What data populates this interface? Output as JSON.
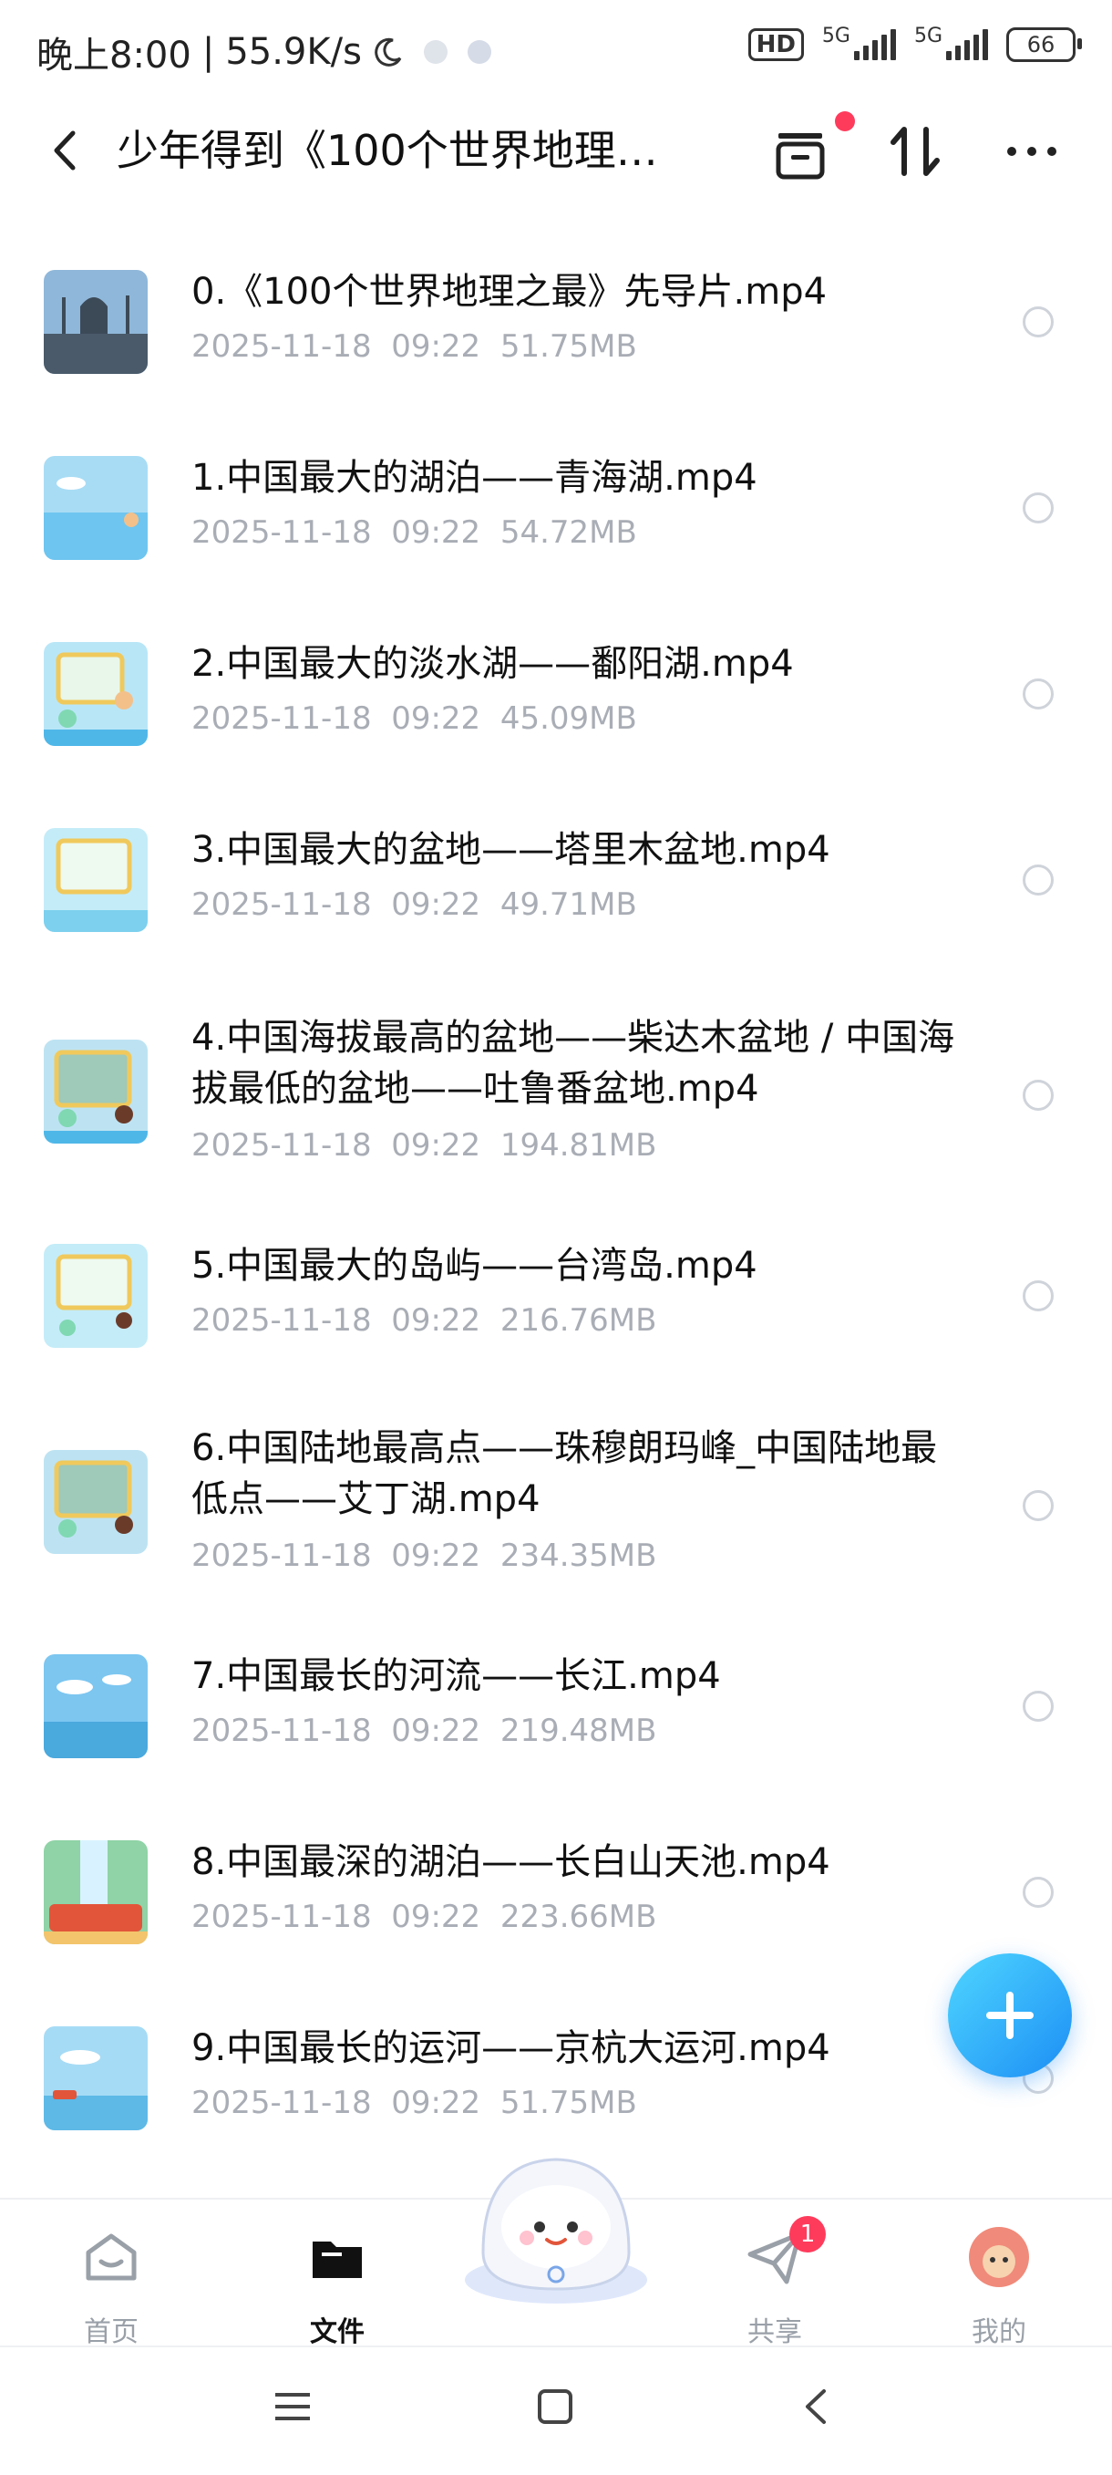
{
  "status_bar": {
    "time": "晚上8:00",
    "speed": "55.9K/s",
    "hd": "HD",
    "net1": "5G",
    "net2": "5G",
    "battery": "66"
  },
  "header": {
    "title": "少年得到《100个世界地理…",
    "icons": [
      "back-icon",
      "archive-icon",
      "sort-icon",
      "more-icon"
    ]
  },
  "files": [
    {
      "name": "0.《100个世界地理之最》先导片.mp4",
      "date": "2025-11-18  09:22",
      "size": "51.75MB"
    },
    {
      "name": "1.中国最大的湖泊——青海湖.mp4",
      "date": "2025-11-18  09:22",
      "size": "54.72MB"
    },
    {
      "name": "2.中国最大的淡水湖——鄱阳湖.mp4",
      "date": "2025-11-18  09:22",
      "size": "45.09MB"
    },
    {
      "name": "3.中国最大的盆地——塔里木盆地.mp4",
      "date": "2025-11-18  09:22",
      "size": "49.71MB"
    },
    {
      "name": "4.中国海拔最高的盆地——柴达木盆地 / 中国海拔最低的盆地——吐鲁番盆地.mp4",
      "date": "2025-11-18  09:22",
      "size": "194.81MB"
    },
    {
      "name": "5.中国最大的岛屿——台湾岛.mp4",
      "date": "2025-11-18  09:22",
      "size": "216.76MB"
    },
    {
      "name": "6.中国陆地最高点——珠穆朗玛峰_中国陆地最低点——艾丁湖.mp4",
      "date": "2025-11-18  09:22",
      "size": "234.35MB"
    },
    {
      "name": "7.中国最长的河流——长江.mp4",
      "date": "2025-11-18  09:22",
      "size": "219.48MB"
    },
    {
      "name": "8.中国最深的湖泊——长白山天池.mp4",
      "date": "2025-11-18  09:22",
      "size": "223.66MB"
    },
    {
      "name": "9.中国最长的运河——京杭大运河.mp4",
      "date": "2025-11-18  09:22",
      "size": "51.75MB"
    }
  ],
  "nav": {
    "home": "首页",
    "files": "文件",
    "share": "共享",
    "share_badge": "1",
    "mine": "我的"
  },
  "colors": {
    "accent": "#1c8ef5",
    "badge": "#ff3b5c",
    "meta_text": "#a9adb5"
  }
}
